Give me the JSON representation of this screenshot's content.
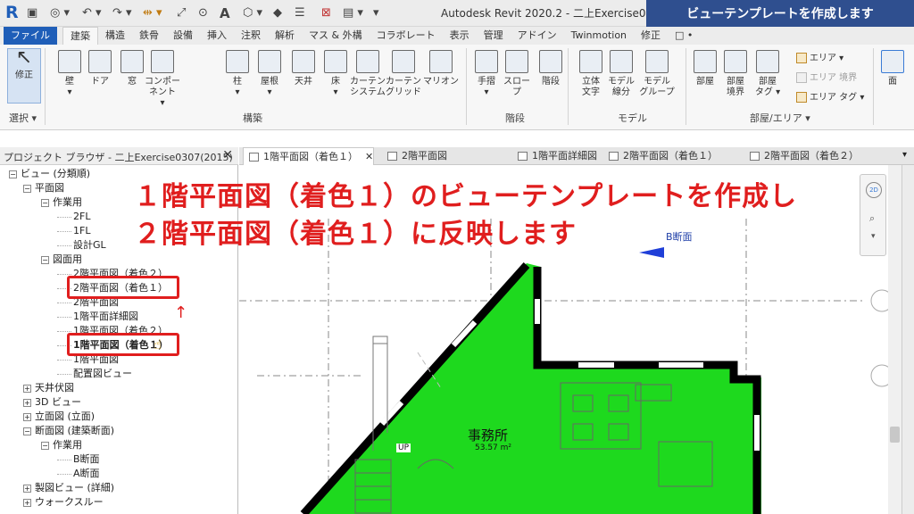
{
  "app": {
    "logo": "R",
    "title": "Autodesk Revit 2020.2 - 二上Exercise0307(2",
    "banner": "ビューテンプレートを作成します"
  },
  "ribbon_tabs": [
    "ファイル",
    "建築",
    "構造",
    "鉄骨",
    "設備",
    "挿入",
    "注釈",
    "解析",
    "マス & 外構",
    "コラボレート",
    "表示",
    "管理",
    "アドイン",
    "Twinmotion",
    "修正",
    "□ •"
  ],
  "ribbon": {
    "select": {
      "label": "修正",
      "panel": "選択 ▾"
    },
    "build_buttons": [
      {
        "label": "壁",
        "sub": "▾"
      },
      {
        "label": "ドア",
        "sub": ""
      },
      {
        "label": "窓",
        "sub": ""
      },
      {
        "label": "コンポーネント",
        "sub": "▾"
      },
      {
        "label": "柱",
        "sub": "▾"
      },
      {
        "label": "屋根",
        "sub": "▾"
      },
      {
        "label": "天井",
        "sub": ""
      },
      {
        "label": "床",
        "sub": "▾"
      },
      {
        "label": "カーテン",
        "sub": "システム"
      },
      {
        "label": "カーテン",
        "sub": "グリッド"
      },
      {
        "label": "マリオン",
        "sub": ""
      }
    ],
    "build_panel": "構築",
    "stairs_buttons": [
      {
        "label": "手摺",
        "sub": "▾"
      },
      {
        "label": "スロープ",
        "sub": ""
      },
      {
        "label": "階段",
        "sub": ""
      }
    ],
    "stairs_panel": "階段",
    "model_buttons": [
      {
        "label": "立体",
        "sub": "文字"
      },
      {
        "label": "モデル",
        "sub": "線分"
      },
      {
        "label": "モデル",
        "sub": "グループ"
      }
    ],
    "model_panel": "モデル",
    "room_buttons": [
      {
        "label": "部屋",
        "sub": ""
      },
      {
        "label": "部屋",
        "sub": "境界"
      },
      {
        "label": "部屋",
        "sub": "タグ ▾"
      }
    ],
    "room_small": [
      "エリア ▾",
      "エリア 境界",
      "エリア タグ ▾"
    ],
    "room_panel": "部屋/エリア ▾",
    "face_label": "面"
  },
  "project_browser": {
    "title": "プロジェクト ブラウザ - 二上Exercise0307(2015)",
    "close": "✕",
    "items": [
      {
        "label": "ビュー (分類順)",
        "tog": "−"
      },
      {
        "label": "平面図",
        "tog": "−"
      },
      {
        "label": "作業用",
        "tog": "−"
      },
      {
        "label": "2FL",
        "tog": ""
      },
      {
        "label": "1FL",
        "tog": ""
      },
      {
        "label": "設計GL",
        "tog": ""
      },
      {
        "label": "図面用",
        "tog": "−"
      },
      {
        "label": "2階平面図（着色２）",
        "tog": ""
      },
      {
        "label": "2階平面図（着色１）",
        "tog": ""
      },
      {
        "label": "2階平面図",
        "tog": ""
      },
      {
        "label": "1階平面詳細図",
        "tog": ""
      },
      {
        "label": "1階平面図（着色２）",
        "tog": ""
      },
      {
        "label": "1階平面図（着色１）",
        "tog": ""
      },
      {
        "label": "1階平面図",
        "tog": ""
      },
      {
        "label": "配置図ビュー",
        "tog": ""
      },
      {
        "label": "天井伏図",
        "tog": "+"
      },
      {
        "label": "3D ビュー",
        "tog": "+"
      },
      {
        "label": "立面図 (立面)",
        "tog": "+"
      },
      {
        "label": "断面図 (建築断面)",
        "tog": "−"
      },
      {
        "label": "作業用",
        "tog": "−"
      },
      {
        "label": "B断面",
        "tog": ""
      },
      {
        "label": "A断面",
        "tog": ""
      },
      {
        "label": "製図ビュー (詳細)",
        "tog": "+"
      },
      {
        "label": "ウォークスルー",
        "tog": "+"
      }
    ],
    "arrow": "↑"
  },
  "view_tabs": [
    {
      "label": "1階平面図（着色１）",
      "close": "✕"
    },
    {
      "label": "2階平面図"
    },
    {
      "label": "1階平面詳細図"
    },
    {
      "label": "2階平面図（着色１）"
    },
    {
      "label": "2階平面図（着色２）"
    }
  ],
  "view_tabs_menu": "▾",
  "canvas": {
    "overlay_line1": "１階平面図（着色１）のビューテンプレートを作成し",
    "overlay_line2": "２階平面図（着色１）に反映します",
    "section_label": "B断面",
    "room_name": "事務所",
    "room_area": "53.57 m²",
    "up_label": "UP",
    "room_fill": "#1ed91e",
    "nav_2d": "2D"
  },
  "colors": {
    "accent": "#1f5eb8",
    "highlight": "#e01e1e",
    "banner": "#2f4f8f"
  }
}
